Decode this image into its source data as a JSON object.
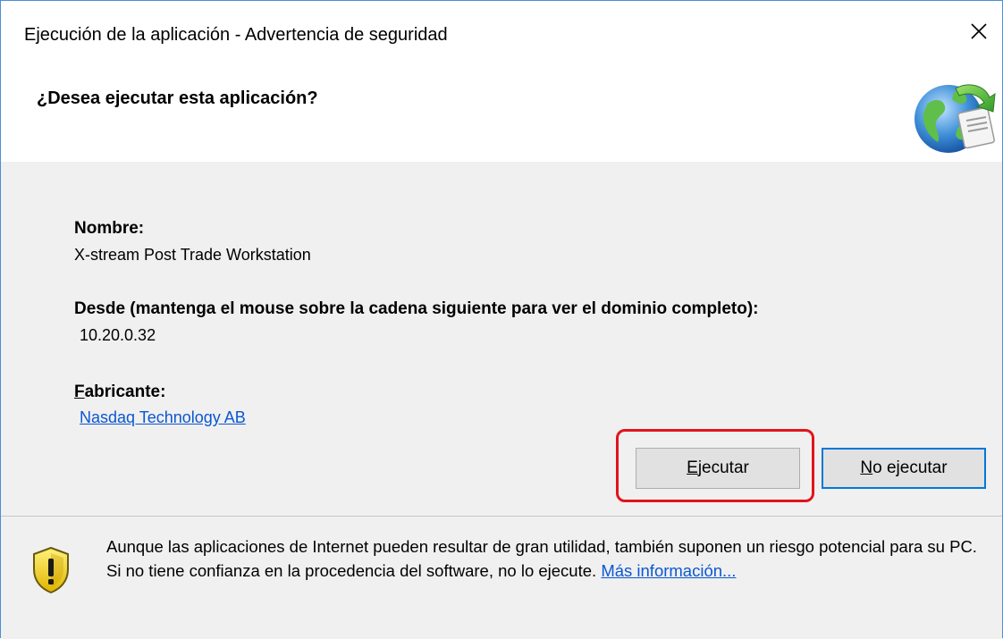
{
  "window": {
    "title": "Ejecución de la aplicación - Advertencia de seguridad",
    "close_glyph": "✕"
  },
  "header": {
    "question": "¿Desea ejecutar esta aplicación?",
    "icon": "application-globe-icon"
  },
  "details": {
    "name_label": "Nombre:",
    "name_value": "X-stream Post Trade Workstation",
    "from_label": "Desde (mantenga el mouse sobre la cadena siguiente para ver el dominio completo):",
    "from_value": "10.20.0.32",
    "publisher_label": "Fabricante:",
    "publisher_value": "Nasdaq Technology AB"
  },
  "buttons": {
    "run_label": "Ejecutar",
    "no_run_label": "No ejecutar"
  },
  "footer": {
    "icon": "shield-warning-icon",
    "warning_text": "Aunque las aplicaciones de Internet pueden resultar de gran utilidad, también suponen un riesgo potencial para su PC. Si no tiene confianza en la procedencia del software, no lo ejecute.",
    "more_info_link": "Más información..."
  },
  "colors": {
    "highlight": "#e2141c",
    "link": "#0b57d0",
    "default_button_border": "#0078d7",
    "panel_background": "#f0f0f0"
  }
}
